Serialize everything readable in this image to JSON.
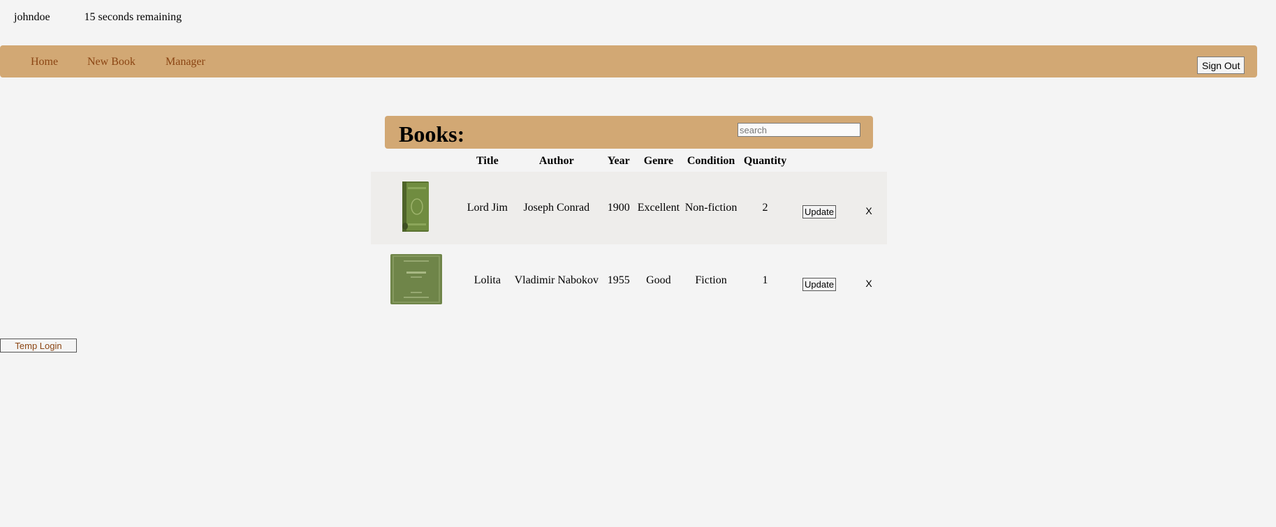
{
  "session": {
    "username": "johndoe",
    "timer": "15 seconds remaining"
  },
  "nav": {
    "items": [
      {
        "label": "Home"
      },
      {
        "label": "New Book"
      },
      {
        "label": "Manager"
      }
    ],
    "signout_label": "Sign Out"
  },
  "books": {
    "title": "Books:",
    "search_placeholder": "search",
    "columns": [
      "Title",
      "Author",
      "Year",
      "Genre",
      "Condition",
      "Quantity"
    ],
    "rows": [
      {
        "title": "Lord Jim",
        "author": "Joseph Conrad",
        "year": "1900",
        "genre": "Excellent",
        "condition": "Non-fiction",
        "quantity": "2",
        "update_label": "Update",
        "delete_label": "X"
      },
      {
        "title": "Lolita",
        "author": "Vladimir Nabokov",
        "year": "1955",
        "genre": "Good",
        "condition": "Fiction",
        "quantity": "1",
        "update_label": "Update",
        "delete_label": "X"
      }
    ]
  },
  "temp_login_label": "Temp Login",
  "colors": {
    "background": "#f4f4f4",
    "accent": "#d2a874",
    "link": "#8b4513",
    "row_alt": "#eeedeb",
    "book_cover": "#6e8a3e"
  }
}
